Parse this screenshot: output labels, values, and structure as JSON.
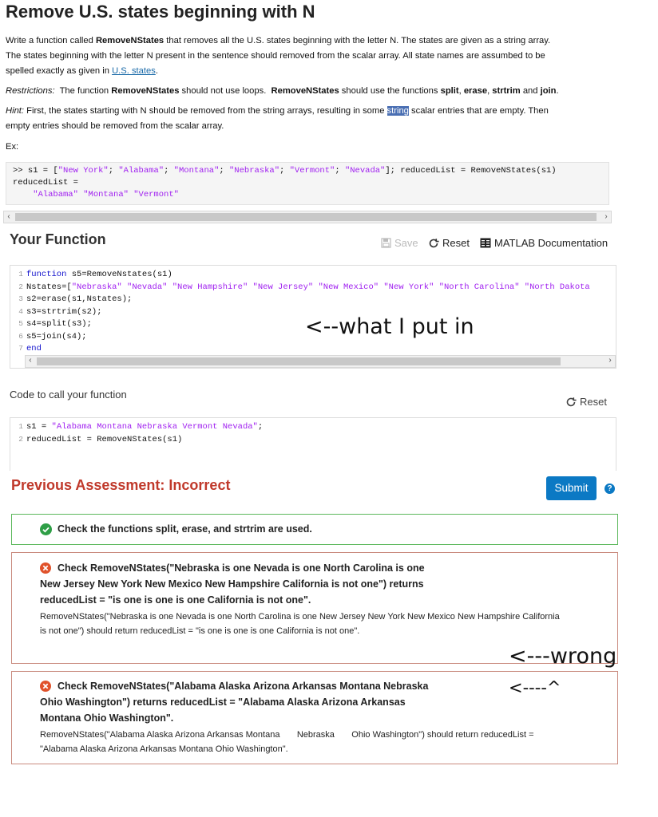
{
  "page": {
    "title": "Remove U.S. states beginning with N"
  },
  "description": {
    "p1_a": "Write a function called ",
    "p1_fn": "RemoveNStates",
    "p1_b": " that removes all the U.S. states beginning with the letter N. The states are given as a string array.",
    "p1_c": "The states beginning with the letter N present in the sentence should removed from the scalar array.  All state names are assumbed to be",
    "p1_d": "spelled exactly as given in ",
    "p1_link": "U.S. states",
    "p1_e": ".",
    "restrictions_label": "Restrictions:",
    "restrictions_a": "  The function ",
    "restrictions_fn": "RemoveNStates",
    "restrictions_b": " should not use loops.  ",
    "restrictions_fn2": "RemoveNStates",
    "restrictions_c": " should use the functions ",
    "restrictions_split": "split",
    "restrictions_comma1": ", ",
    "restrictions_erase": "erase",
    "restrictions_comma2": ", ",
    "restrictions_strtrim": "strtrim",
    "restrictions_and": " and ",
    "restrictions_join": "join",
    "restrictions_end": ".",
    "hint_label": "Hint:",
    "hint_a": " First, the states starting with N should be removed from the string arrays, resulting in some ",
    "hint_hl": "string",
    "hint_b": " scalar entries that are empty. Then",
    "hint_c": "empty entries should be removed from the scalar array.",
    "ex_label": "Ex:"
  },
  "example": {
    "line1_a": ">> s1 = [",
    "line1_s1": "\"New York\"",
    "line1_sep1": "; ",
    "line1_s2": "\"Alabama\"",
    "line1_sep2": "; ",
    "line1_s3": "\"Montana\"",
    "line1_sep3": "; ",
    "line1_s4": "\"Nebraska\"",
    "line1_sep4": "; ",
    "line1_s5": "\"Vermont\"",
    "line1_sep5": "; ",
    "line1_s6": "\"Nevada\"",
    "line1_b": "]; reducedList = RemoveNStates(s1)",
    "line2": "reducedList =",
    "line3": "    \"Alabama\" \"Montana\" \"Vermont\""
  },
  "your_function": {
    "title": "Your Function",
    "save_label": "Save",
    "reset_label": "Reset",
    "docs_label": "MATLAB Documentation",
    "lines": [
      {
        "n": "1",
        "kw": "function",
        "rest": " s5=RemoveNstates(s1)"
      },
      {
        "n": "2",
        "pre": "Nstates=[",
        "strs": "\"Nebraska\" \"Nevada\" \"New Hampshire\" \"New Jersey\" \"New Mexico\" \"New York\" \"North Carolina\" \"North Dakota"
      },
      {
        "n": "3",
        "text": "s2=erase(s1,Nstates);"
      },
      {
        "n": "4",
        "text": "s3=strtrim(s2);"
      },
      {
        "n": "5",
        "text": "s4=split(s3);"
      },
      {
        "n": "6",
        "text": "s5=join(s4);"
      },
      {
        "n": "7",
        "kw": "end"
      }
    ],
    "annotation": "<--what I put in"
  },
  "call_code": {
    "title": "Code to call your function",
    "reset_label": "Reset",
    "line1_n": "1",
    "line1_a": "s1 = ",
    "line1_str": "\"Alabama Montana Nebraska Vermont Nevada\"",
    "line1_b": ";",
    "line2_n": "2",
    "line2": "reducedList = RemoveNStates(s1)"
  },
  "assessment": {
    "title": "Previous Assessment: Incorrect",
    "submit_label": "Submit",
    "help_glyph": "?",
    "check1": "Check the functions split, erase, and strtrim are used.",
    "check2_l1": "Check RemoveNStates(\"Nebraska is one Nevada is one North Carolina is one",
    "check2_l2": "New Jersey New York New Mexico New Hampshire California is not one\") returns",
    "check2_l3": "reducedList = \"is one is one is one California is not one\".",
    "check2_d1": "RemoveNStates(\"Nebraska is one Nevada is one North Carolina is one New Jersey New York New Mexico New Hampshire California",
    "check2_d2": "is not one\") should return reducedList = \"is one is one is one California is not one\".",
    "check3_l1": "Check RemoveNStates(\"Alabama Alaska Arizona Arkansas Montana Nebraska",
    "check3_l2": "Ohio Washington\") returns reducedList = \"Alabama Alaska Arizona Arkansas",
    "check3_l3": "Montana Ohio Washington\".",
    "check3_d1": "RemoveNStates(\"Alabama Alaska Arizona Arkansas Montana       Nebraska       Ohio Washington\") should return reducedList =",
    "check3_d2": "\"Alabama Alaska Arizona Arkansas Montana Ohio Washington\".",
    "annot_wrong": "<---wrong",
    "annot_caret": "<----^"
  },
  "colors": {
    "pass": "#2e9e46",
    "fail": "#e0522b",
    "title_red": "#c0392b",
    "accent": "#0b79c4"
  }
}
